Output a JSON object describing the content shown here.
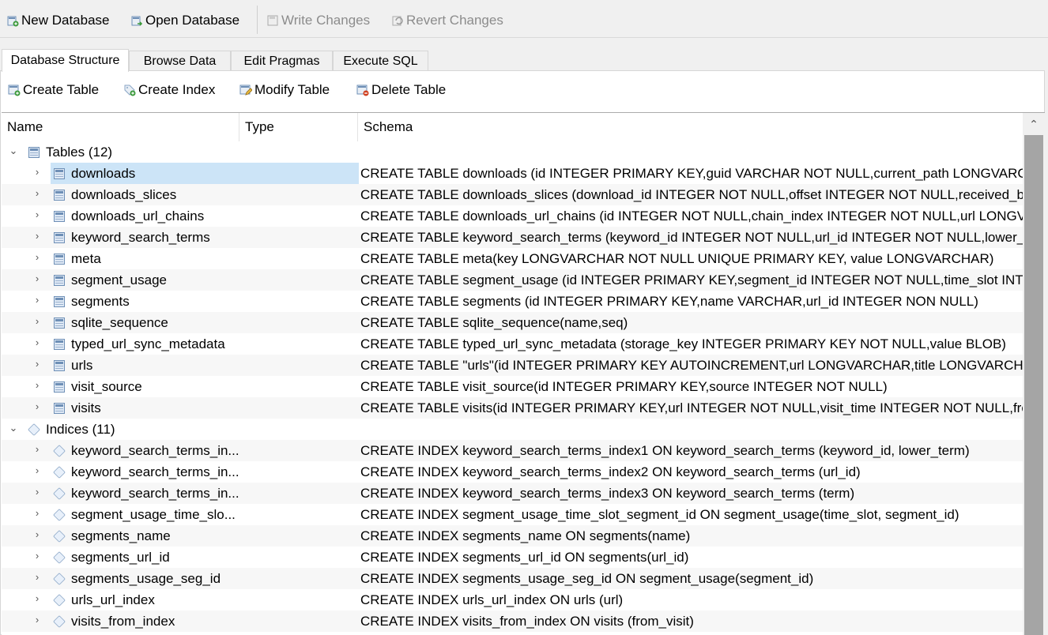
{
  "toolbar": {
    "new_database": "New Database",
    "open_database": "Open Database",
    "write_changes": "Write Changes",
    "revert_changes": "Revert Changes"
  },
  "tabs": [
    "Database Structure",
    "Browse Data",
    "Edit Pragmas",
    "Execute SQL"
  ],
  "active_tab": "Database Structure",
  "structure_toolbar": {
    "create_table": "Create Table",
    "create_index": "Create Index",
    "modify_table": "Modify Table",
    "delete_table": "Delete Table"
  },
  "columns": [
    "Name",
    "Type",
    "Schema"
  ],
  "groups": {
    "tables": {
      "label": "Tables (12)",
      "items": [
        {
          "name": "downloads",
          "schema": "CREATE TABLE downloads (id INTEGER PRIMARY KEY,guid VARCHAR NOT NULL,current_path LONGVARCHAR"
        },
        {
          "name": "downloads_slices",
          "schema": "CREATE TABLE downloads_slices (download_id INTEGER NOT NULL,offset INTEGER NOT NULL,received_bytes"
        },
        {
          "name": "downloads_url_chains",
          "schema": "CREATE TABLE downloads_url_chains (id INTEGER NOT NULL,chain_index INTEGER NOT NULL,url LONGVARCHAR"
        },
        {
          "name": "keyword_search_terms",
          "schema": "CREATE TABLE keyword_search_terms (keyword_id INTEGER NOT NULL,url_id INTEGER NOT NULL,lower_term"
        },
        {
          "name": "meta",
          "schema": "CREATE TABLE meta(key LONGVARCHAR NOT NULL UNIQUE PRIMARY KEY, value LONGVARCHAR)"
        },
        {
          "name": "segment_usage",
          "schema": "CREATE TABLE segment_usage (id INTEGER PRIMARY KEY,segment_id INTEGER NOT NULL,time_slot INTEGER"
        },
        {
          "name": "segments",
          "schema": "CREATE TABLE segments (id INTEGER PRIMARY KEY,name VARCHAR,url_id INTEGER NON NULL)"
        },
        {
          "name": "sqlite_sequence",
          "schema": "CREATE TABLE sqlite_sequence(name,seq)"
        },
        {
          "name": "typed_url_sync_metadata",
          "schema": "CREATE TABLE typed_url_sync_metadata (storage_key INTEGER PRIMARY KEY NOT NULL,value BLOB)"
        },
        {
          "name": "urls",
          "schema": "CREATE TABLE \"urls\"(id INTEGER PRIMARY KEY AUTOINCREMENT,url LONGVARCHAR,title LONGVARCHAR,visit_count"
        },
        {
          "name": "visit_source",
          "schema": "CREATE TABLE visit_source(id INTEGER PRIMARY KEY,source INTEGER NOT NULL)"
        },
        {
          "name": "visits",
          "schema": "CREATE TABLE visits(id INTEGER PRIMARY KEY,url INTEGER NOT NULL,visit_time INTEGER NOT NULL,from_visit"
        }
      ]
    },
    "indices": {
      "label": "Indices (11)",
      "items": [
        {
          "name": "keyword_search_terms_in...",
          "schema": "CREATE INDEX keyword_search_terms_index1 ON keyword_search_terms (keyword_id, lower_term)"
        },
        {
          "name": "keyword_search_terms_in...",
          "schema": "CREATE INDEX keyword_search_terms_index2 ON keyword_search_terms (url_id)"
        },
        {
          "name": "keyword_search_terms_in...",
          "schema": "CREATE INDEX keyword_search_terms_index3 ON keyword_search_terms (term)"
        },
        {
          "name": "segment_usage_time_slo...",
          "schema": "CREATE INDEX segment_usage_time_slot_segment_id ON segment_usage(time_slot, segment_id)"
        },
        {
          "name": "segments_name",
          "schema": "CREATE INDEX segments_name ON segments(name)"
        },
        {
          "name": "segments_url_id",
          "schema": "CREATE INDEX segments_url_id ON segments(url_id)"
        },
        {
          "name": "segments_usage_seg_id",
          "schema": "CREATE INDEX segments_usage_seg_id ON segment_usage(segment_id)"
        },
        {
          "name": "urls_url_index",
          "schema": "CREATE INDEX urls_url_index ON urls (url)"
        },
        {
          "name": "visits_from_index",
          "schema": "CREATE INDEX visits_from_index ON visits (from_visit)"
        }
      ]
    }
  },
  "selected_item": "downloads",
  "colors": {
    "selection": "#cce4f7",
    "scrollbar_thumb": "#a5a5a5"
  }
}
